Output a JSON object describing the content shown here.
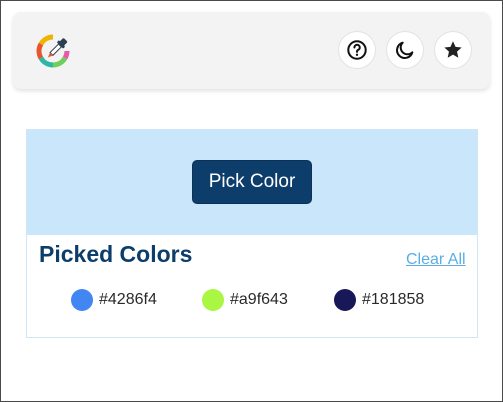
{
  "header": {
    "logo_icon": "color-picker-logo-icon",
    "help_icon": "question-circle-icon",
    "theme_icon": "moon-icon",
    "favorite_icon": "star-icon"
  },
  "picker": {
    "button_label": "Pick Color",
    "background": "#c9e6fb",
    "button_color": "#0d3d6b"
  },
  "picked": {
    "title": "Picked Colors",
    "clear_label": "Clear All",
    "colors": [
      {
        "hex": "#4286f4",
        "label": "#4286f4"
      },
      {
        "hex": "#a9f643",
        "label": "#a9f643"
      },
      {
        "hex": "#181858",
        "label": "#181858"
      }
    ]
  }
}
